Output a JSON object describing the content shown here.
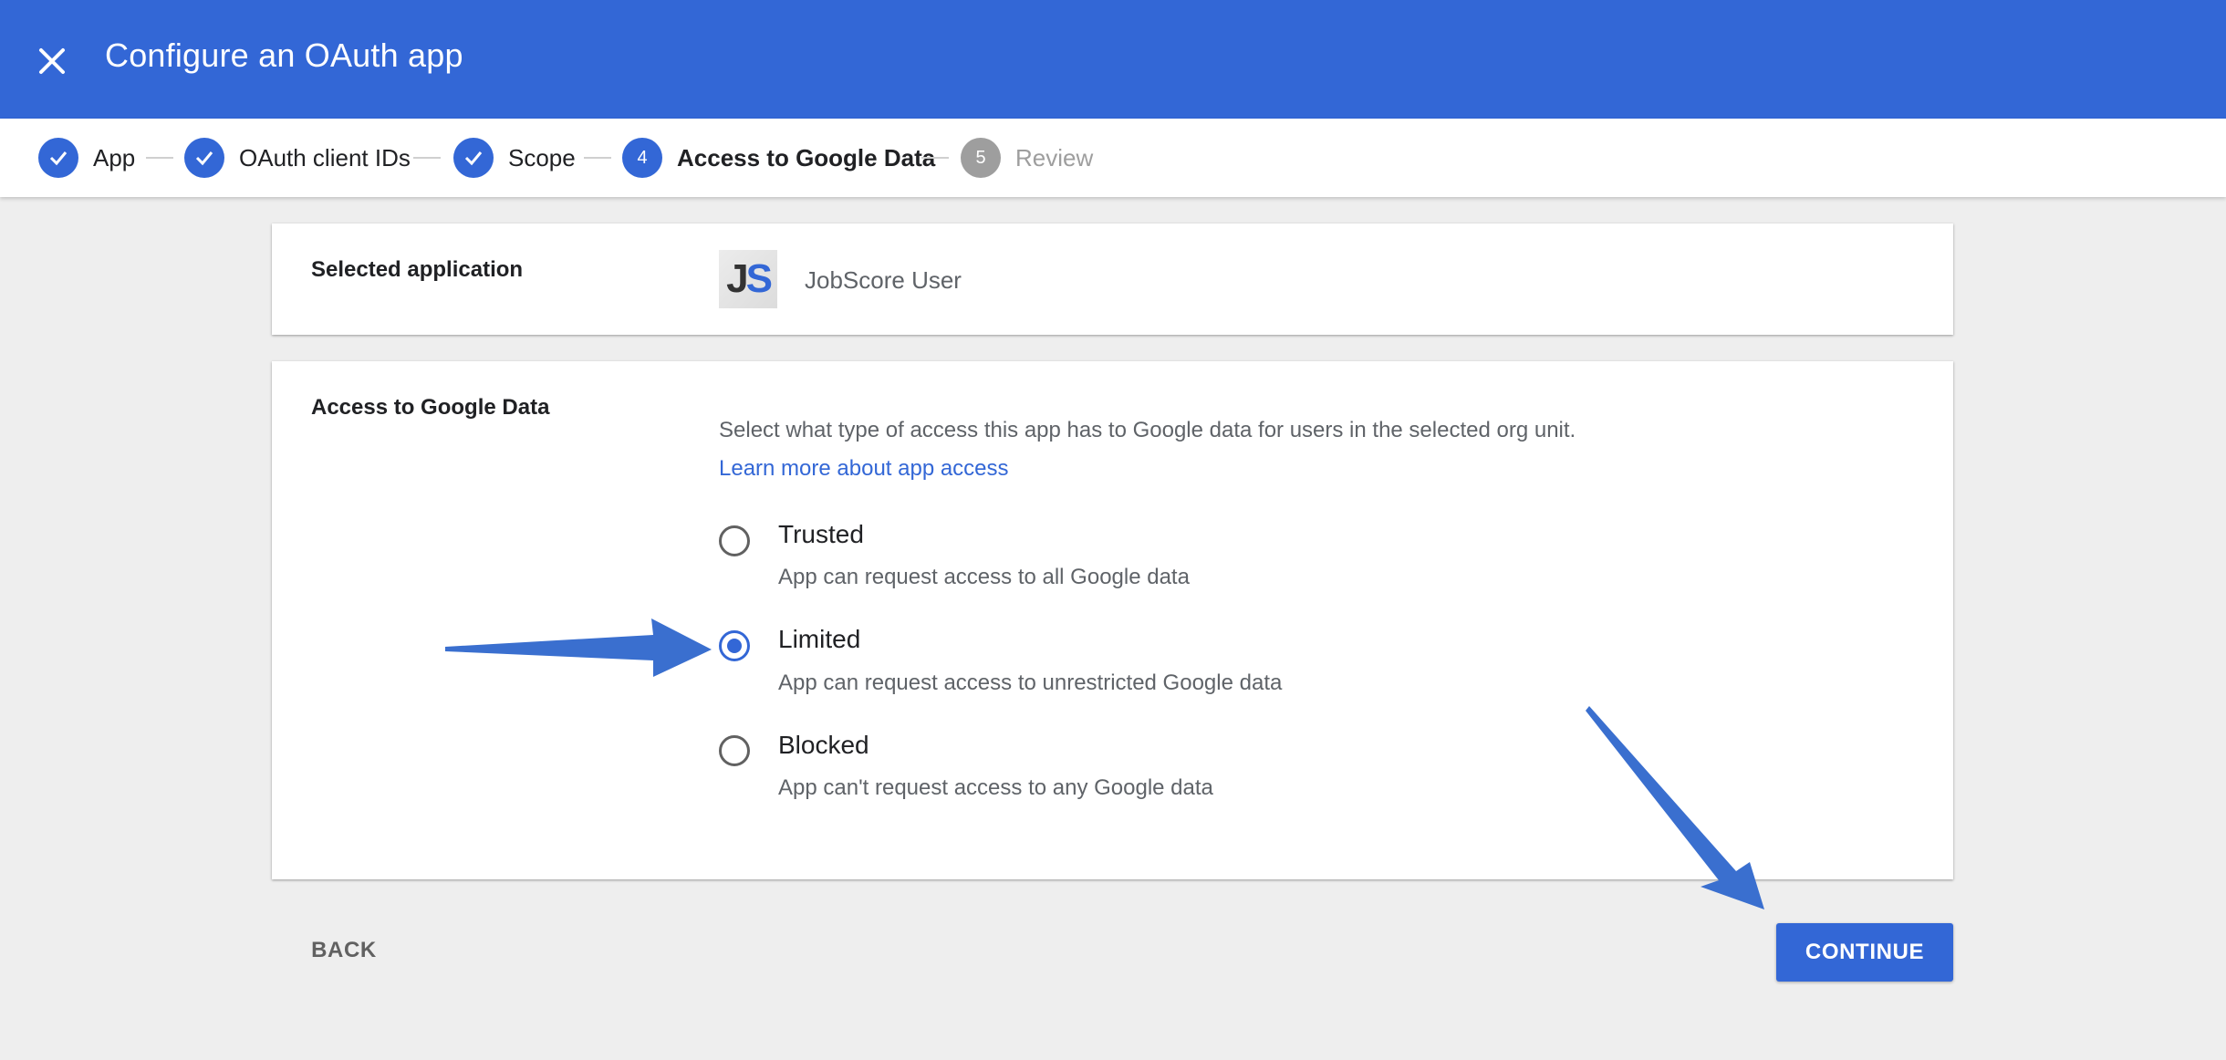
{
  "header": {
    "title": "Configure an OAuth app",
    "close_icon": "close-icon",
    "background_color": "#3367d6"
  },
  "stepper": {
    "steps": [
      {
        "label": "App",
        "status": "complete",
        "marker": "check-icon"
      },
      {
        "label": "OAuth client IDs",
        "status": "complete",
        "marker": "check-icon"
      },
      {
        "label": "Scope",
        "status": "complete",
        "marker": "check-icon"
      },
      {
        "label": "Access to Google Data",
        "status": "active",
        "marker": "4"
      },
      {
        "label": "Review",
        "status": "upcoming",
        "marker": "5"
      }
    ]
  },
  "selected_app": {
    "label": "Selected application",
    "logo_text_j": "J",
    "logo_text_s": "S",
    "name": "JobScore User"
  },
  "access": {
    "label": "Access to Google Data",
    "description": "Select what type of access this app has to Google data for users in the selected org unit.",
    "learn_more": "Learn more about app access",
    "selected": "Limited",
    "options": [
      {
        "title": "Trusted",
        "subtitle": "App can request access to all Google data"
      },
      {
        "title": "Limited",
        "subtitle": "App can request access to unrestricted Google data"
      },
      {
        "title": "Blocked",
        "subtitle": "App can't request access to any Google data"
      }
    ]
  },
  "footer": {
    "back_label": "BACK",
    "continue_label": "CONTINUE"
  },
  "annotations": {
    "arrow_color": "#3a6fcf",
    "arrows": [
      "arrow-to-limited-option",
      "arrow-to-continue-button"
    ]
  }
}
